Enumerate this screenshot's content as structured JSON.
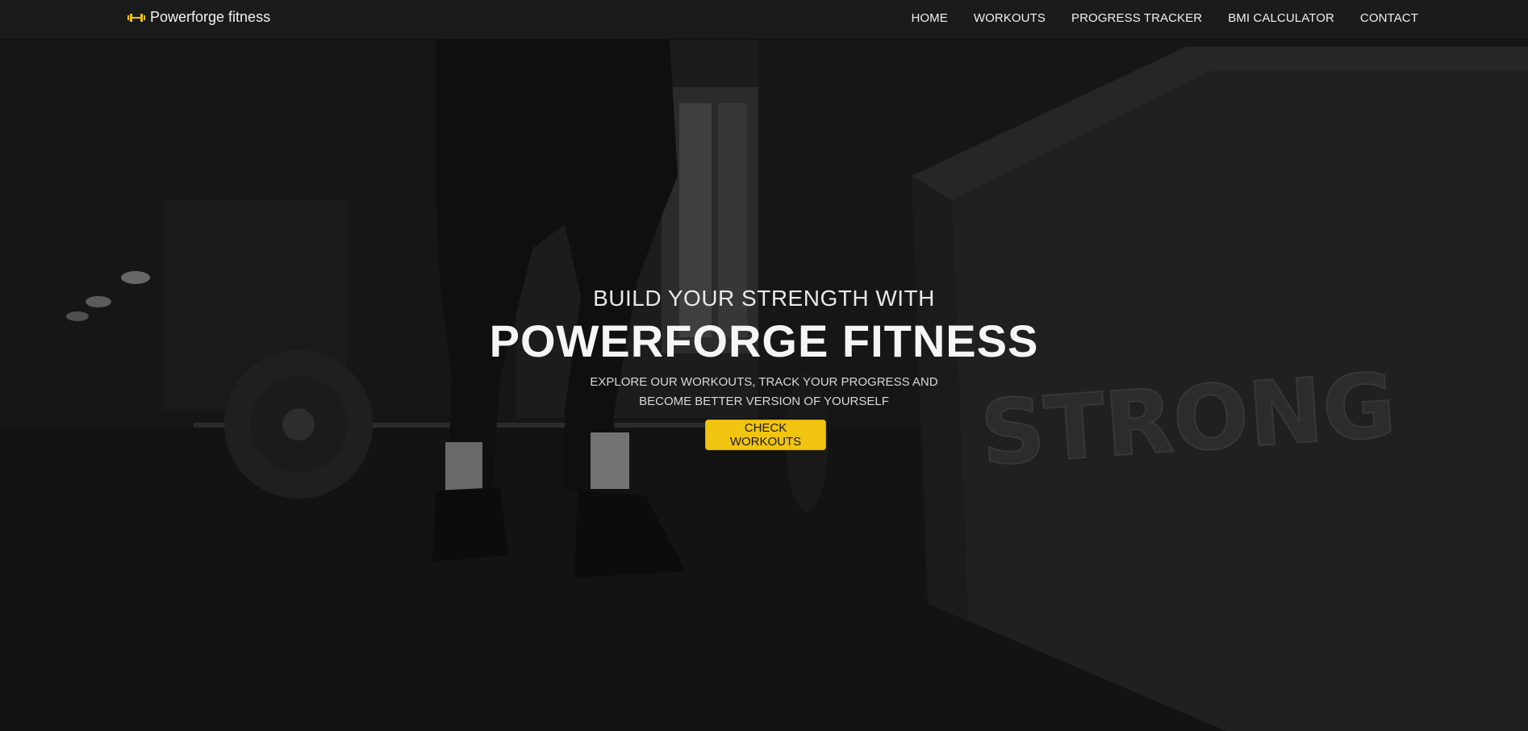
{
  "brand": {
    "name": "Powerforge fitness",
    "icon": "dumbbell-icon",
    "icon_color": "#f1c40f"
  },
  "nav": {
    "items": [
      {
        "label": "HOME"
      },
      {
        "label": "WORKOUTS"
      },
      {
        "label": "PROGRESS TRACKER"
      },
      {
        "label": "BMI CALCULATOR"
      },
      {
        "label": "CONTACT"
      }
    ]
  },
  "hero": {
    "eyebrow": "BUILD YOUR STRENGTH WITH",
    "title": "POWERFORGE FITNESS",
    "subtitle": "EXPLORE OUR WORKOUTS, TRACK YOUR PROGRESS AND BECOME BETTER VERSION OF YOURSELF",
    "cta_label": "CHECK WORKOUTS",
    "background_box_text": "STRONG"
  },
  "colors": {
    "accent": "#f1c40f",
    "navbar_bg": "#1b1b1b",
    "hero_overlay": "#111111"
  }
}
